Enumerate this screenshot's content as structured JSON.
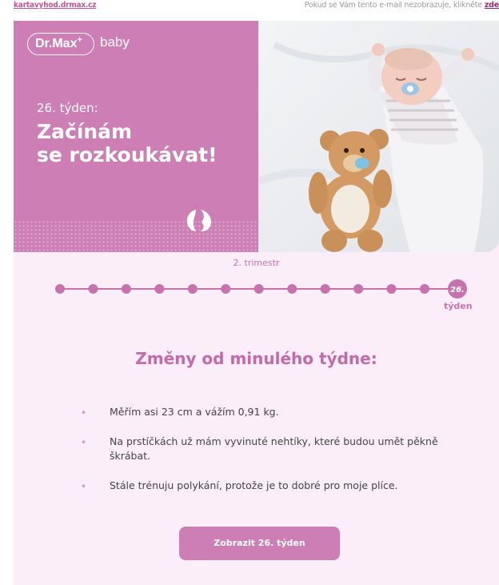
{
  "top_bar": {
    "domain_link": "kartavyhod.drmax.cz",
    "notice_text": "Pokud se Vám tento e-mail nezobrazuje, klikněte ",
    "notice_link": "zde"
  },
  "hero": {
    "logo": "Dr.Max",
    "logo_plus": "+",
    "logo_baby": "baby",
    "week_label": "26. týden:",
    "headline_line1": "Začínám",
    "headline_line2": "se rozkoukávat!",
    "colors": {
      "panel": "#cd7eb4",
      "accent": "#c46aa8"
    }
  },
  "timeline": {
    "trimester": "2. trimestr",
    "current_week": "26.",
    "current_week_suffix": "týden",
    "previous_week_dots": 12
  },
  "changes": {
    "title": "Změny od minulého týdne:",
    "items": [
      "Měřím asi 23 cm a vážím 0,91 kg.",
      "Na prstíčkách už mám vyvinuté nehtíky, které budou umět pěkně škrábat.",
      "Stále trénuju polykání, protože je to dobré pro moje plíce."
    ]
  },
  "cta": {
    "label": "Zobrazit 26. týden"
  }
}
